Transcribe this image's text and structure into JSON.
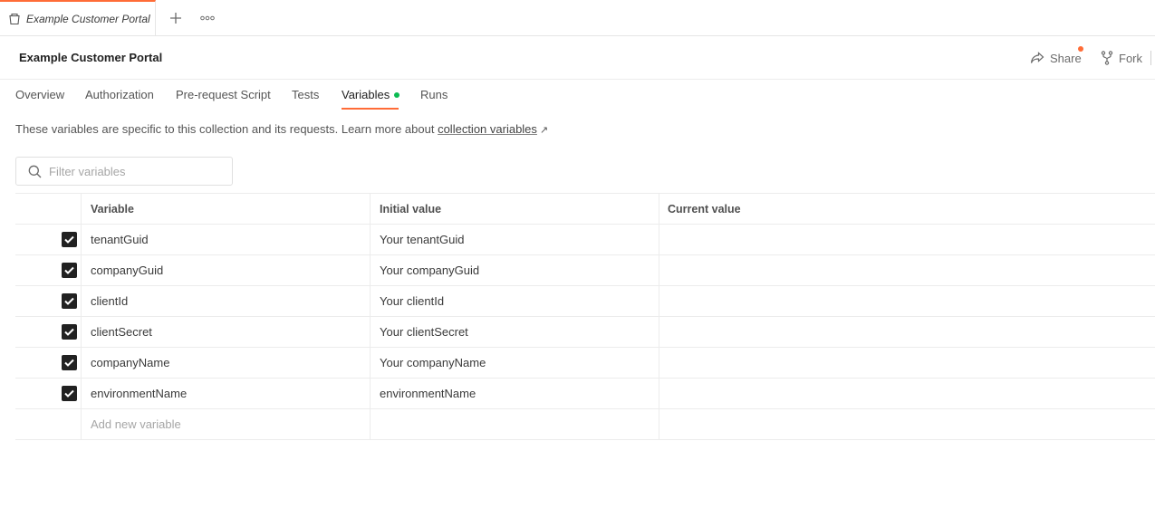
{
  "tab": {
    "title": "Example Customer Portal",
    "icon": "collection-icon"
  },
  "tabstrip": {
    "new_tab_icon": "plus-icon",
    "more_icon": "more-horizontal-icon"
  },
  "header": {
    "title": "Example Customer Portal",
    "share_label": "Share",
    "fork_label": "Fork",
    "accent_color": "#ff6c37"
  },
  "subtabs": [
    {
      "label": "Overview"
    },
    {
      "label": "Authorization"
    },
    {
      "label": "Pre-request Script"
    },
    {
      "label": "Tests"
    },
    {
      "label": "Variables",
      "active": true,
      "status_dot_color": "#0cbb52"
    },
    {
      "label": "Runs"
    }
  ],
  "description": {
    "text": "These variables are specific to this collection and its requests. Learn more about ",
    "link_text": "collection variables",
    "link_arrow": "↗"
  },
  "filter": {
    "placeholder": "Filter variables"
  },
  "table": {
    "headers": {
      "variable": "Variable",
      "initial": "Initial value",
      "current": "Current value"
    },
    "rows": [
      {
        "checked": true,
        "variable": "tenantGuid",
        "initial": "Your tenantGuid",
        "current": ""
      },
      {
        "checked": true,
        "variable": "companyGuid",
        "initial": "Your companyGuid",
        "current": ""
      },
      {
        "checked": true,
        "variable": "clientId",
        "initial": "Your clientId",
        "current": ""
      },
      {
        "checked": true,
        "variable": "clientSecret",
        "initial": "Your clientSecret",
        "current": ""
      },
      {
        "checked": true,
        "variable": "companyName",
        "initial": "Your companyName",
        "current": ""
      },
      {
        "checked": true,
        "variable": "environmentName",
        "initial": "environmentName",
        "current": ""
      }
    ],
    "add_placeholder": "Add new variable"
  }
}
